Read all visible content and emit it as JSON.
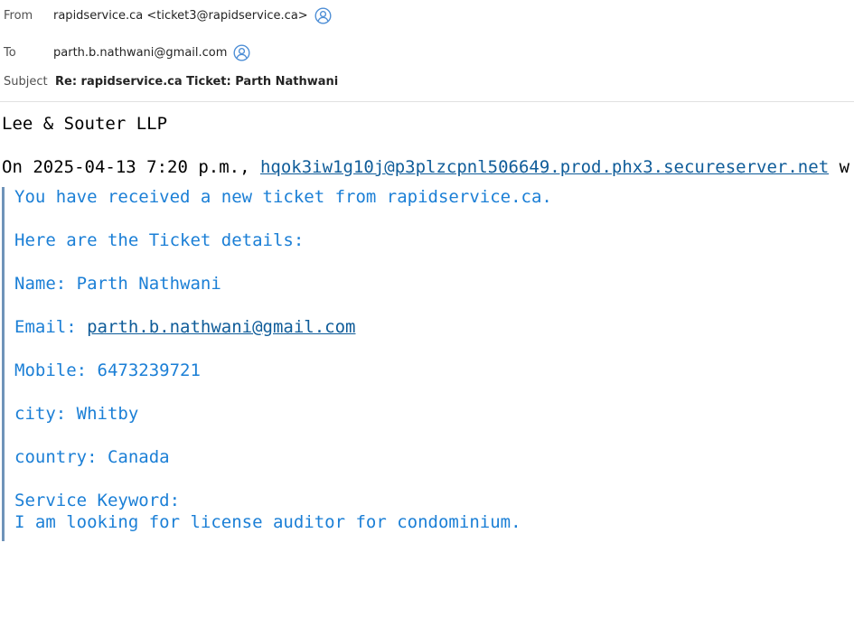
{
  "header": {
    "from_label": "From",
    "from_value": "rapidservice.ca <ticket3@rapidservice.ca>",
    "to_label": "To",
    "to_value": "parth.b.nathwani@gmail.com",
    "subject_label": "Subject",
    "subject_value": "Re: rapidservice.ca Ticket: Parth Nathwani",
    "icon": "contact-card-icon",
    "accent_color": "#4f8fd6"
  },
  "body": {
    "signature": "Lee & Souter LLP",
    "attribution_prefix": "On 2025-04-13 7:20 p.m., ",
    "attribution_link": "hqok3iw1g10j@p3plzcpnl506649.prod.phx3.secureserver.net",
    "attribution_suffix": " w",
    "quote": {
      "intro": "You have received a new ticket from rapidservice.ca.",
      "details_heading": "Here are the Ticket details:",
      "name_line": "Name: Parth Nathwani",
      "email_label": "Email: ",
      "email_link": "parth.b.nathwani@gmail.com",
      "mobile_line": "Mobile: 6473239721",
      "city_line": "city: Whitby",
      "country_line": "country: Canada",
      "keyword_label": "Service Keyword:",
      "keyword_value": "I am looking for license auditor for condominium."
    },
    "text_color": "#1b7fd6",
    "link_color": "#0f5c99",
    "quote_bar_color": "#6f93b9"
  }
}
